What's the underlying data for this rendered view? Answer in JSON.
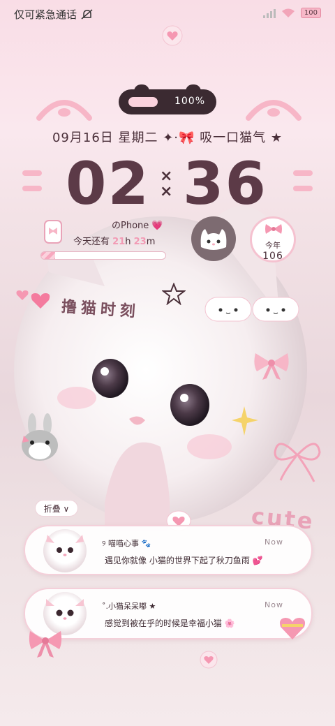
{
  "status_bar": {
    "carrier_text": "仅可紧急通话",
    "silent_icon": "bell-off-icon",
    "battery_level": "100",
    "signal_icon": "signal-icon",
    "wifi_icon": "wifi-icon"
  },
  "pill": {
    "percent_text": "100%",
    "fill_fraction": 0.3
  },
  "date_line": "09月16日  星期二  ✦·🎀 吸一口猫气 ★",
  "time": {
    "hours": "02",
    "minutes": "36",
    "separator": "×\n×"
  },
  "widget": {
    "phone_label": "のPhone 💗",
    "countdown_prefix": "今天还有",
    "hours_left": "21",
    "hour_unit": "h",
    "minutes_left": "23",
    "minute_unit": "m",
    "day_progress": 0.11
  },
  "year_widget": {
    "label": "今年",
    "days": "106"
  },
  "pet_text": "撸猫时刻",
  "cute_text": "cute",
  "fold_button": "折叠 ∨",
  "notifications": [
    {
      "title": "୨ 喵喵心事 🐾",
      "body": "遇见你就像 小猫的世界下起了秋刀鱼雨 💕",
      "time": "Now"
    },
    {
      "title": "˚.小猫呆呆嘟 ★",
      "body": "感觉到被在乎的时候是幸福小猫 🌸",
      "time": "Now"
    }
  ],
  "colors": {
    "accent_pink": "#f29ab4",
    "dark_text": "#5c3a47",
    "pill_bg": "#3b2a31"
  }
}
